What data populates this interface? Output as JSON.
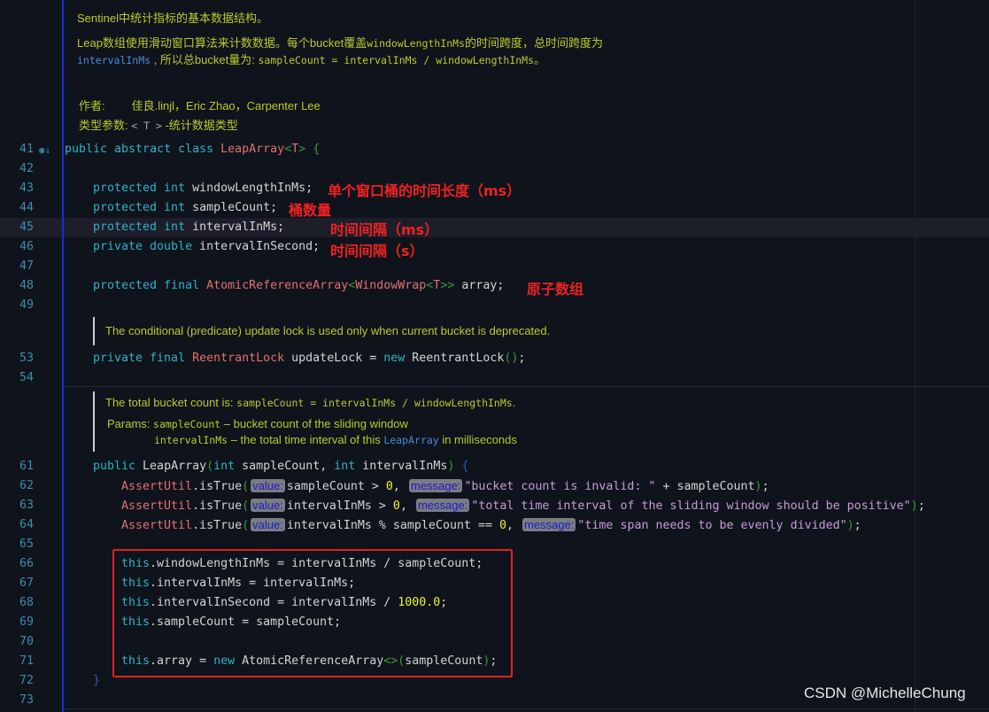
{
  "class_doc": {
    "line1": "Sentinel中统计指标的基本数据结构。",
    "line2a": "Leap数组使用滑动窗口算法来计数数据。每个bucket覆盖",
    "line2b": "windowLengthInMs",
    "line2c": "的时间跨度，总时间跨度为",
    "line3a": "intervalInMs",
    "line3b": " , 所以总bucket量为: ",
    "line3c": "sampleCount = intervalInMs / windowLengthInMs",
    "line3d": "。",
    "author_label": "作者:",
    "author_value": "佳良.linjl，Eric Zhao，Carpenter Lee",
    "type_label": "类型参数: ",
    "type_value": "< T >",
    "type_desc": " -统计数据类型"
  },
  "lock_doc": "The conditional (predicate) update lock is used only when current bucket is deprecated.",
  "ctor_doc": {
    "l1a": "The total bucket count is: ",
    "l1b": "sampleCount = intervalInMs / windowLengthInMs",
    ".": ".",
    "params_label": "Params: ",
    "p1name": "sampleCount",
    "p1desc": " – bucket count of the sliding window",
    "p2name": "intervalInMs",
    "p2desc": " – the total time interval of this ",
    "p2cls": "LeapArray",
    "p2end": " in milliseconds"
  },
  "lines": [
    {
      "n": "41",
      "indent": 0,
      "t": [
        [
          "kw",
          "public abstract class "
        ],
        [
          "ty",
          "LeapArray"
        ],
        [
          "gr",
          "<"
        ],
        [
          "ty",
          "T"
        ],
        [
          "gr",
          "> {"
        ]
      ]
    },
    {
      "n": "42",
      "indent": 0,
      "t": []
    },
    {
      "n": "43",
      "indent": 1,
      "t": [
        [
          "kw",
          "protected int "
        ],
        [
          "id",
          "windowLengthInMs;"
        ]
      ]
    },
    {
      "n": "44",
      "indent": 1,
      "t": [
        [
          "kw",
          "protected int "
        ],
        [
          "id",
          "sampleCount;"
        ]
      ]
    },
    {
      "n": "45",
      "indent": 1,
      "t": [
        [
          "kw",
          "protected int "
        ],
        [
          "id",
          "intervalInMs;"
        ]
      ]
    },
    {
      "n": "46",
      "indent": 1,
      "t": [
        [
          "kw",
          "private double "
        ],
        [
          "id",
          "intervalInSecond;"
        ]
      ]
    },
    {
      "n": "47",
      "indent": 0,
      "t": []
    },
    {
      "n": "48",
      "indent": 1,
      "t": [
        [
          "kw",
          "protected final "
        ],
        [
          "ty",
          "AtomicReferenceArray"
        ],
        [
          "gr",
          "<"
        ],
        [
          "ty",
          "WindowWrap"
        ],
        [
          "gr",
          "<"
        ],
        [
          "ty",
          "T"
        ],
        [
          "gr",
          ">>"
        ],
        [
          "id",
          " array;"
        ]
      ]
    },
    {
      "n": "49",
      "indent": 0,
      "t": []
    },
    {
      "n": "53",
      "indent": 1,
      "t": [
        [
          "kw",
          "private final "
        ],
        [
          "ty",
          "ReentrantLock"
        ],
        [
          "id",
          " updateLock = "
        ],
        [
          "kw",
          "new "
        ],
        [
          "id",
          "ReentrantLock"
        ],
        [
          "gr",
          "()"
        ],
        [
          "id",
          ";"
        ]
      ]
    },
    {
      "n": "54",
      "indent": 0,
      "t": []
    },
    {
      "n": "61",
      "indent": 1,
      "t": [
        [
          "kw",
          "public "
        ],
        [
          "id",
          "LeapArray"
        ],
        [
          "gr",
          "("
        ],
        [
          "kw",
          "int "
        ],
        [
          "id",
          "sampleCount, "
        ],
        [
          "kw",
          "int "
        ],
        [
          "id",
          "intervalInMs"
        ],
        [
          "gr",
          ")"
        ],
        [
          "bl",
          " {"
        ]
      ]
    },
    {
      "n": "62",
      "indent": 2,
      "t": [
        [
          "ty",
          "AssertUtil"
        ],
        [
          "id",
          ".isTrue"
        ],
        [
          "gr",
          "("
        ],
        [
          "hint",
          "value:"
        ],
        [
          "id",
          "sampleCount > "
        ],
        [
          "num",
          "0"
        ],
        [
          "id",
          ", "
        ],
        [
          "hint",
          "message:"
        ],
        [
          "str",
          "\"bucket count is invalid: \""
        ],
        [
          "id",
          " + sampleCount"
        ],
        [
          "gr",
          ")"
        ],
        [
          "id",
          ";"
        ]
      ]
    },
    {
      "n": "63",
      "indent": 2,
      "t": [
        [
          "ty",
          "AssertUtil"
        ],
        [
          "id",
          ".isTrue"
        ],
        [
          "gr",
          "("
        ],
        [
          "hint",
          "value:"
        ],
        [
          "id",
          "intervalInMs > "
        ],
        [
          "num",
          "0"
        ],
        [
          "id",
          ", "
        ],
        [
          "hint",
          "message:"
        ],
        [
          "str",
          "\"total time interval of the sliding window should be positive\""
        ],
        [
          "gr",
          ")"
        ],
        [
          "id",
          ";"
        ]
      ]
    },
    {
      "n": "64",
      "indent": 2,
      "t": [
        [
          "ty",
          "AssertUtil"
        ],
        [
          "id",
          ".isTrue"
        ],
        [
          "gr",
          "("
        ],
        [
          "hint",
          "value:"
        ],
        [
          "id",
          "intervalInMs % sampleCount == "
        ],
        [
          "num",
          "0"
        ],
        [
          "id",
          ", "
        ],
        [
          "hint",
          "message:"
        ],
        [
          "str",
          "\"time span needs to be evenly divided\""
        ],
        [
          "gr",
          ")"
        ],
        [
          "id",
          ";"
        ]
      ]
    },
    {
      "n": "65",
      "indent": 0,
      "t": []
    },
    {
      "n": "66",
      "indent": 2,
      "t": [
        [
          "kw",
          "this"
        ],
        [
          "id",
          ".windowLengthInMs = intervalInMs / sampleCount;"
        ]
      ]
    },
    {
      "n": "67",
      "indent": 2,
      "t": [
        [
          "kw",
          "this"
        ],
        [
          "id",
          ".intervalInMs = intervalInMs;"
        ]
      ]
    },
    {
      "n": "68",
      "indent": 2,
      "t": [
        [
          "kw",
          "this"
        ],
        [
          "id",
          ".intervalInSecond = intervalInMs / "
        ],
        [
          "num",
          "1000.0"
        ],
        [
          "id",
          ";"
        ]
      ]
    },
    {
      "n": "69",
      "indent": 2,
      "t": [
        [
          "kw",
          "this"
        ],
        [
          "id",
          ".sampleCount = sampleCount;"
        ]
      ]
    },
    {
      "n": "70",
      "indent": 0,
      "t": []
    },
    {
      "n": "71",
      "indent": 2,
      "t": [
        [
          "kw",
          "this"
        ],
        [
          "id",
          ".array = "
        ],
        [
          "kw",
          "new "
        ],
        [
          "id",
          "AtomicReferenceArray"
        ],
        [
          "gr",
          "<>("
        ],
        [
          "id",
          "sampleCount"
        ],
        [
          "gr",
          ")"
        ],
        [
          "id",
          ";"
        ]
      ]
    },
    {
      "n": "72",
      "indent": 1,
      "t": [
        [
          "bl",
          "}"
        ]
      ]
    },
    {
      "n": "73",
      "indent": 0,
      "t": []
    }
  ],
  "annotations": {
    "window_length": "单个窗口桶的时间长度（ms）",
    "sample_count": "桶数量",
    "interval_ms": "时间间隔（ms）",
    "interval_s": "时间间隔（s）",
    "array": "原子数组"
  },
  "watermark": "CSDN @MichelleChung"
}
